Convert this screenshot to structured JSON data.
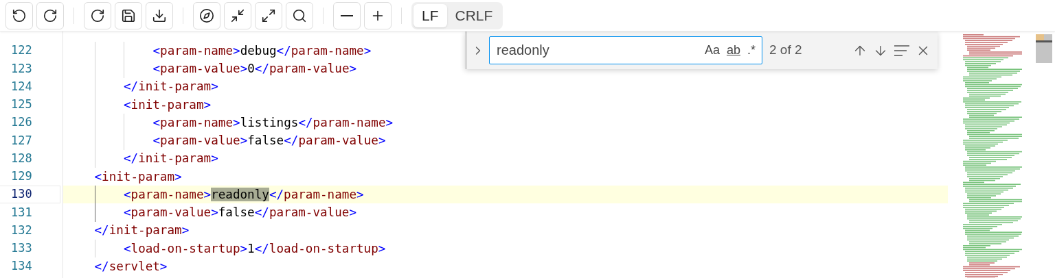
{
  "toolbar": {
    "line_endings": [
      {
        "label": "LF",
        "selected": true
      },
      {
        "label": "CRLF",
        "selected": false
      }
    ]
  },
  "editor": {
    "lines": [
      {
        "children": [
          {
            "children": [
              {
                "number": "122",
                "current": false,
                "tokens": [
                  {
                    "kind": "punct",
                    "text": "<"
                  },
                  {
                    "kind": "tag",
                    "text": "param-name"
                  },
                  {
                    "kind": "punct",
                    "text": ">"
                  },
                  {
                    "kind": "text",
                    "text": "debug"
                  },
                  {
                    "kind": "punct",
                    "text": "</"
                  },
                  {
                    "kind": "tag",
                    "text": "param-name"
                  },
                  {
                    "kind": "punct",
                    "text": ">"
                  }
                ]
              },
              {
                "number": "123",
                "current": false,
                "tokens": [
                  {
                    "kind": "punct",
                    "text": "<"
                  },
                  {
                    "kind": "tag",
                    "text": "param-value"
                  },
                  {
                    "kind": "punct",
                    "text": ">"
                  },
                  {
                    "kind": "text",
                    "text": "0"
                  },
                  {
                    "kind": "punct",
                    "text": "</"
                  },
                  {
                    "kind": "tag",
                    "text": "param-value"
                  },
                  {
                    "kind": "punct",
                    "text": ">"
                  }
                ]
              }
            ]
          },
          {
            "number": "124",
            "current": false,
            "tokens": [
              {
                "kind": "punct",
                "text": "</"
              },
              {
                "kind": "tag",
                "text": "init-param"
              },
              {
                "kind": "punct",
                "text": ">"
              }
            ]
          },
          {
            "number": "125",
            "current": false,
            "tokens": [
              {
                "kind": "punct",
                "text": "<"
              },
              {
                "kind": "tag",
                "text": "init-param"
              },
              {
                "kind": "punct",
                "text": ">"
              }
            ],
            "children": [
              {
                "number": "126",
                "current": false,
                "tokens": [
                  {
                    "kind": "punct",
                    "text": "<"
                  },
                  {
                    "kind": "tag",
                    "text": "param-name"
                  },
                  {
                    "kind": "punct",
                    "text": ">"
                  },
                  {
                    "kind": "text",
                    "text": "listings"
                  },
                  {
                    "kind": "punct",
                    "text": "</"
                  },
                  {
                    "kind": "tag",
                    "text": "param-name"
                  },
                  {
                    "kind": "punct",
                    "text": ">"
                  }
                ]
              },
              {
                "number": "127",
                "current": false,
                "tokens": [
                  {
                    "kind": "punct",
                    "text": "<"
                  },
                  {
                    "kind": "tag",
                    "text": "param-value"
                  },
                  {
                    "kind": "punct",
                    "text": ">"
                  },
                  {
                    "kind": "text",
                    "text": "false"
                  },
                  {
                    "kind": "punct",
                    "text": "</"
                  },
                  {
                    "kind": "tag",
                    "text": "param-value"
                  },
                  {
                    "kind": "punct",
                    "text": ">"
                  }
                ]
              }
            ]
          },
          {
            "number": "128",
            "current": false,
            "tokens": [
              {
                "kind": "punct",
                "text": "</"
              },
              {
                "kind": "tag",
                "text": "init-param"
              },
              {
                "kind": "punct",
                "text": ">"
              }
            ]
          }
        ]
      },
      {
        "number": "129",
        "current": false,
        "tokens": [
          {
            "kind": "punct",
            "text": "<"
          },
          {
            "kind": "tag",
            "text": "init-param"
          },
          {
            "kind": "punct",
            "text": ">"
          }
        ],
        "children": [
          {
            "number": "130",
            "current": true,
            "tokens": [
              {
                "kind": "punct",
                "text": "<"
              },
              {
                "kind": "tag",
                "text": "param-name"
              },
              {
                "kind": "punct",
                "text": ">"
              },
              {
                "kind": "match",
                "text": "readonly"
              },
              {
                "kind": "punct",
                "text": "</"
              },
              {
                "kind": "tag",
                "text": "param-name"
              },
              {
                "kind": "punct",
                "text": ">"
              }
            ]
          },
          {
            "number": "131",
            "current": false,
            "tokens": [
              {
                "kind": "punct",
                "text": "<"
              },
              {
                "kind": "tag",
                "text": "param-value"
              },
              {
                "kind": "punct",
                "text": ">"
              },
              {
                "kind": "text",
                "text": "false"
              },
              {
                "kind": "punct",
                "text": "</"
              },
              {
                "kind": "tag",
                "text": "param-value"
              },
              {
                "kind": "punct",
                "text": ">"
              }
            ]
          }
        ]
      },
      {
        "number": "132",
        "current": false,
        "tokens": [
          {
            "kind": "punct",
            "text": "</"
          },
          {
            "kind": "tag",
            "text": "init-param"
          },
          {
            "kind": "punct",
            "text": ">"
          }
        ],
        "children": [
          {
            "number": "133",
            "current": false,
            "tokens": [
              {
                "kind": "punct",
                "text": "<"
              },
              {
                "kind": "tag",
                "text": "load-on-startup"
              },
              {
                "kind": "punct",
                "text": ">"
              },
              {
                "kind": "text",
                "text": "1"
              },
              {
                "kind": "punct",
                "text": "</"
              },
              {
                "kind": "tag",
                "text": "load-on-startup"
              },
              {
                "kind": "punct",
                "text": ">"
              }
            ]
          }
        ]
      },
      {
        "number": "134",
        "current": false,
        "tokens": [
          {
            "kind": "punct",
            "text": "</"
          },
          {
            "kind": "tag",
            "text": "servlet"
          },
          {
            "kind": "punct",
            "text": ">"
          }
        ]
      }
    ]
  },
  "find_widget": {
    "query": "readonly",
    "options": [
      {
        "label": "Aa"
      },
      {
        "label": "ab"
      },
      {
        "label": ".*"
      }
    ],
    "count": "2 of 2"
  }
}
